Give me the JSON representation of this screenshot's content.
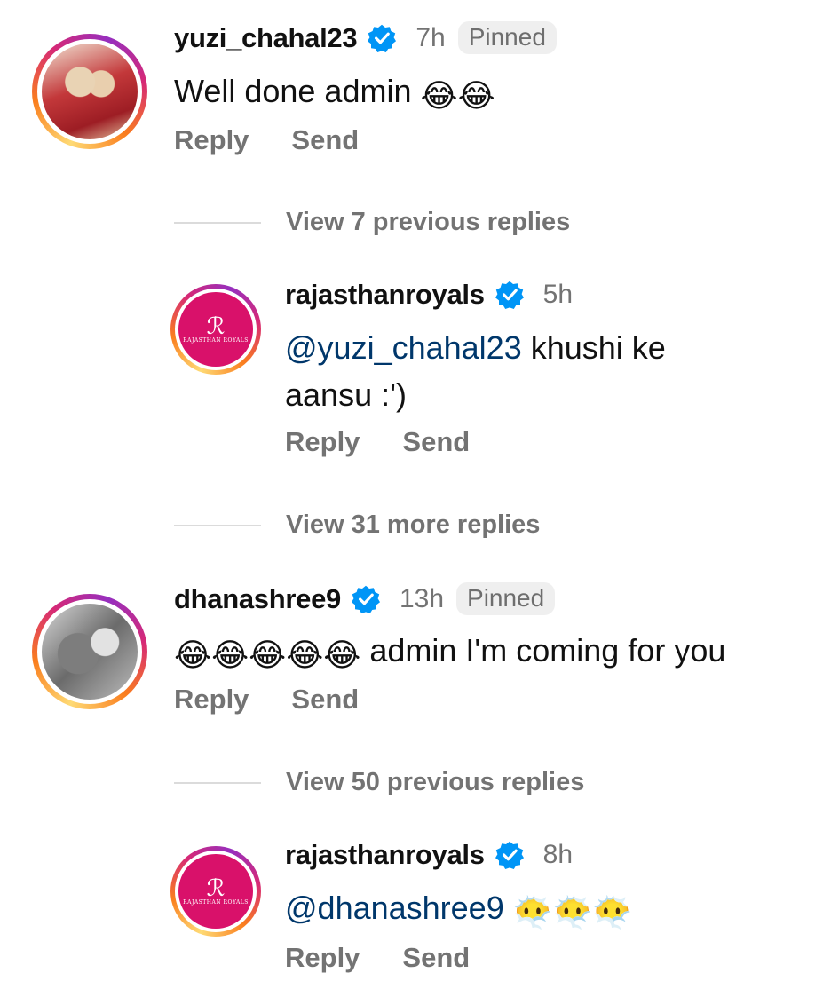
{
  "comments": [
    {
      "username": "yuzi_chahal23",
      "time": "7h",
      "pinned": "Pinned",
      "text": "Well done admin",
      "emoji": "😂😂",
      "reply": "Reply",
      "send": "Send"
    },
    {
      "username": "rajasthanroyals",
      "time": "5h",
      "mention": "@yuzi_chahal23",
      "text_line1": " khushi ke",
      "text_line2": "aansu :')",
      "reply": "Reply",
      "send": "Send",
      "logo_text": "RAJASTHAN ROYALS"
    },
    {
      "username": "dhanashree9",
      "time": "13h",
      "pinned": "Pinned",
      "emoji": "😂😂😂😂😂",
      "text": " admin I'm coming for you",
      "reply": "Reply",
      "send": "Send"
    },
    {
      "username": "rajasthanroyals",
      "time": "8h",
      "mention": "@dhanashree9",
      "emoji": "😶‍🌫️😶‍🌫️😶‍🌫️",
      "reply": "Reply",
      "send": "Send",
      "logo_text": "RAJASTHAN ROYALS"
    }
  ],
  "view_replies": [
    "View 7 previous replies",
    "View 31 more replies",
    "View 50 previous replies"
  ],
  "colors": {
    "mention": "#00376b",
    "verified": "#0095f6",
    "secondary_text": "#737373",
    "rr_pink": "#d9116a"
  }
}
